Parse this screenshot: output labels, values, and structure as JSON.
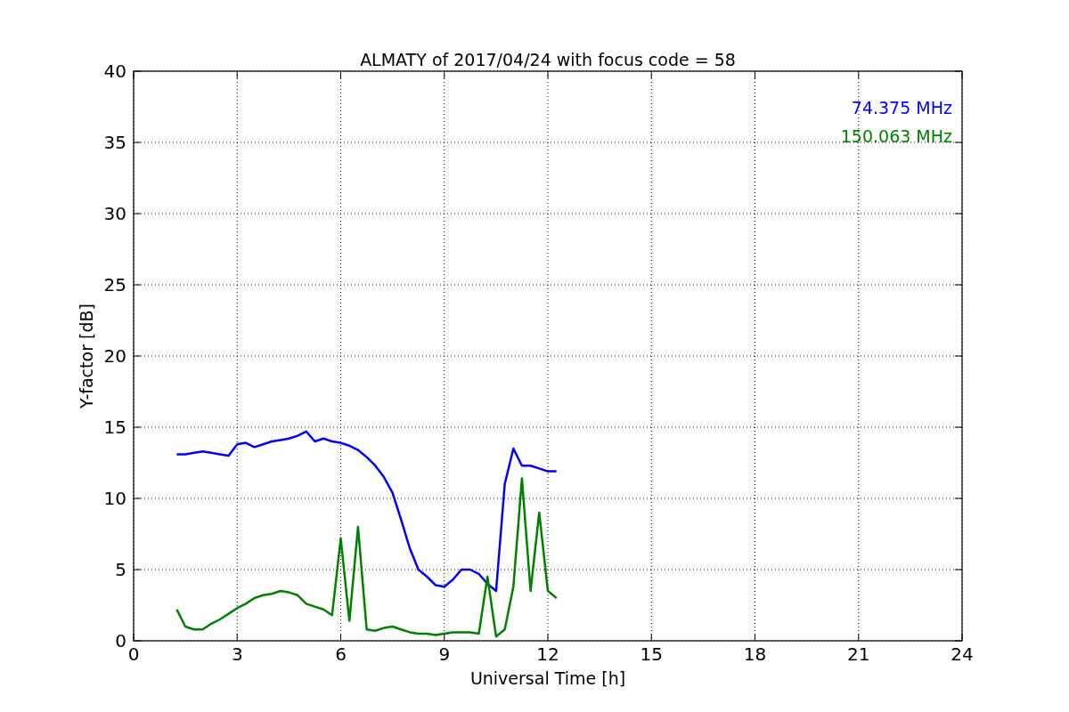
{
  "chart_data": {
    "type": "line",
    "title": "ALMATY of 2017/04/24 with focus code = 58",
    "xlabel": "Universal Time [h]",
    "ylabel": "Y-factor [dB]",
    "x": [
      1.25,
      1.5,
      1.75,
      2.0,
      2.25,
      2.5,
      2.75,
      3.0,
      3.25,
      3.5,
      3.75,
      4.0,
      4.25,
      4.5,
      4.75,
      5.0,
      5.25,
      5.5,
      5.75,
      6.0,
      6.25,
      6.5,
      6.75,
      7.0,
      7.25,
      7.5,
      7.75,
      8.0,
      8.25,
      8.5,
      8.75,
      9.0,
      9.25,
      9.5,
      9.75,
      10.0,
      10.25,
      10.5,
      10.75,
      11.0,
      11.25,
      11.5,
      11.75,
      12.0,
      12.25
    ],
    "series": [
      {
        "name": "74.375 MHz",
        "color": "#0000ff",
        "values": [
          13.1,
          13.1,
          13.2,
          13.3,
          13.2,
          13.1,
          13.0,
          13.8,
          13.9,
          13.6,
          13.8,
          14.0,
          14.1,
          14.2,
          14.4,
          14.7,
          14.0,
          14.2,
          14.0,
          13.9,
          13.7,
          13.4,
          12.9,
          12.3,
          11.5,
          10.4,
          8.5,
          6.5,
          5.0,
          4.5,
          3.9,
          3.8,
          4.3,
          5.0,
          5.0,
          4.7,
          4.0,
          3.5,
          11.0,
          13.5,
          12.3,
          12.3,
          12.1,
          11.9,
          11.9
        ]
      },
      {
        "name": "150.063 MHz",
        "color": "#008000",
        "values": [
          2.2,
          1.0,
          0.8,
          0.8,
          1.2,
          1.5,
          1.9,
          2.3,
          2.6,
          3.0,
          3.2,
          3.3,
          3.5,
          3.4,
          3.2,
          2.6,
          2.4,
          2.2,
          1.8,
          7.2,
          1.4,
          8.0,
          0.8,
          0.7,
          0.9,
          1.0,
          0.8,
          0.6,
          0.5,
          0.5,
          0.4,
          0.5,
          0.6,
          0.6,
          0.6,
          0.5,
          4.5,
          0.3,
          0.8,
          3.8,
          11.4,
          3.5,
          9.0,
          3.5,
          3.0
        ]
      }
    ],
    "xlim": [
      0,
      24
    ],
    "ylim": [
      0,
      40
    ],
    "xticks": [
      0,
      3,
      6,
      9,
      12,
      15,
      18,
      21,
      24
    ],
    "yticks": [
      0,
      5,
      10,
      15,
      20,
      25,
      30,
      35,
      40
    ],
    "grid": true
  }
}
